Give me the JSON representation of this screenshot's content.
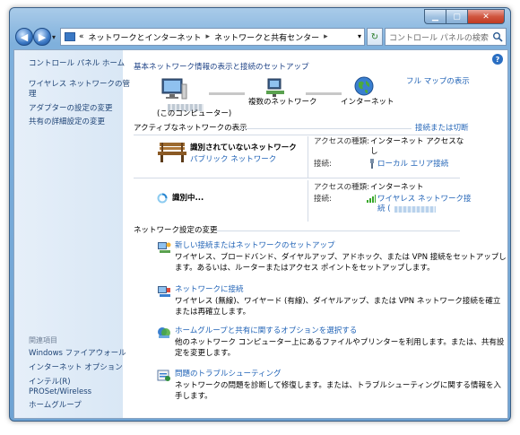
{
  "window": {
    "title_buttons": {
      "min_icon": "minimize-icon",
      "max_icon": "maximize-icon",
      "close_icon": "close-icon",
      "min": "▁",
      "max": "▢",
      "close": "✕"
    }
  },
  "nav": {
    "back_glyph": "◀",
    "forward_glyph": "▶",
    "drop_glyph": "▾",
    "address_prefix": "«",
    "breadcrumb": [
      "ネットワークとインターネット",
      "ネットワークと共有センター"
    ],
    "crumb_sep": "▸",
    "address_drop_glyph": "▾",
    "refresh_glyph": "↻",
    "search_placeholder": "コントロール パネルの検索"
  },
  "sidebar": {
    "home": "コントロール パネル ホーム",
    "links": [
      "ワイヤレス ネットワークの管",
      "理",
      "アダプターの設定の変更",
      "共有の詳細設定の変更"
    ],
    "see_also_label": "関連項目",
    "see_also": [
      "Windows ファイアウォール",
      "インターネット オプション",
      "インテル(R)",
      "PROSet/Wireless",
      "ホームグループ"
    ]
  },
  "main": {
    "help_glyph": "?",
    "top_heading": "基本ネットワーク情報の表示と接続のセットアップ",
    "full_map": "フル マップの表示",
    "map": {
      "computer_label": "(このコンピューター)",
      "network_label": "複数のネットワーク",
      "internet_label": "インターネット"
    },
    "active_heading": "アクティブなネットワークの表示",
    "connect_disconnect": "接続または切断",
    "net1": {
      "name": "識別されていないネットワーク",
      "type": "パブリック ネットワーク",
      "access_label": "アクセスの種類:",
      "access_value_1": "インターネット アクセスな",
      "access_value_2": "し",
      "conn_label": "接続:",
      "conn_value": "ローカル エリア接続"
    },
    "net2": {
      "name": "識別中...",
      "access_label": "アクセスの種類:",
      "access_value": "インターネット",
      "conn_label": "接続:",
      "conn_value_1": "ワイヤレス ネットワーク接",
      "conn_value_2": "続 ("
    },
    "settings_heading": "ネットワーク設定の変更",
    "tasks": [
      {
        "title": "新しい接続またはネットワークのセットアップ",
        "desc1": "ワイヤレス、ブロードバンド、ダイヤルアップ、アドホック、または VPN 接続をセットアップし",
        "desc2": "ます。あるいは、ルーターまたはアクセス ポイントをセットアップします。"
      },
      {
        "title": "ネットワークに接続",
        "desc1": "ワイヤレス (無線)、ワイヤード (有線)、ダイヤルアップ、または VPN ネットワーク接続を確立",
        "desc2": "または再確立します。"
      },
      {
        "title": "ホームグループと共有に関するオプションを選択する",
        "desc1": "他のネットワーク コンピューター上にあるファイルやプリンターを利用します。または、共有設",
        "desc2": "定を変更します。"
      },
      {
        "title": "問題のトラブルシューティング",
        "desc1": "ネットワークの問題を診断して修復します。または、トラブルシューティングに関する情報を入",
        "desc2": "手します。"
      }
    ]
  }
}
